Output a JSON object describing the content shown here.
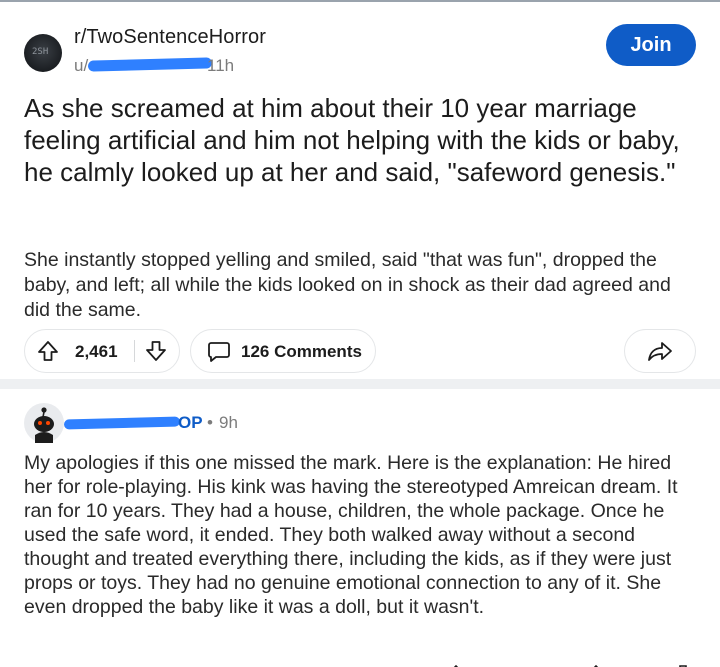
{
  "post": {
    "subreddit": "r/TwoSentenceHorror",
    "subreddit_avatar_text": "2SH",
    "author_prefix": "u/",
    "age": "11h",
    "join_label": "Join",
    "title": "As she screamed at him about their 10 year marriage feeling artificial and him not helping with the kids or baby, he calmly looked up at her and said, \"safeword genesis.\"",
    "body": "She instantly stopped yelling and smiled, said \"that was fun\", dropped the baby, and left; all while the kids looked on in shock as their dad agreed and did the same.",
    "score": "2,461",
    "comments_label": "126 Comments"
  },
  "comment": {
    "op_badge": "OP",
    "separator": "•",
    "age": "9h",
    "body": "My apologies if this one missed the mark.  Here is the explanation: He hired her for role-playing. His kink was having the stereotyped Amreican dream. It ran for 10 years. They had a house, children, the whole package. Once he used the safe word, it ended. They both walked away without a second thought and treated everything there, including the kids, as if they were just props or toys. They had no genuine emotional connection to any of it. She even dropped the baby like it was a doll, but it wasn't."
  },
  "icons": {
    "upvote": "upvote-arrow-icon",
    "downvote": "downvote-arrow-icon",
    "comments": "comment-bubble-icon",
    "share": "share-arrow-icon"
  },
  "colors": {
    "join_button": "#0f5cc7",
    "op_badge": "#0f5cc7",
    "redaction": "#2f80ff"
  }
}
